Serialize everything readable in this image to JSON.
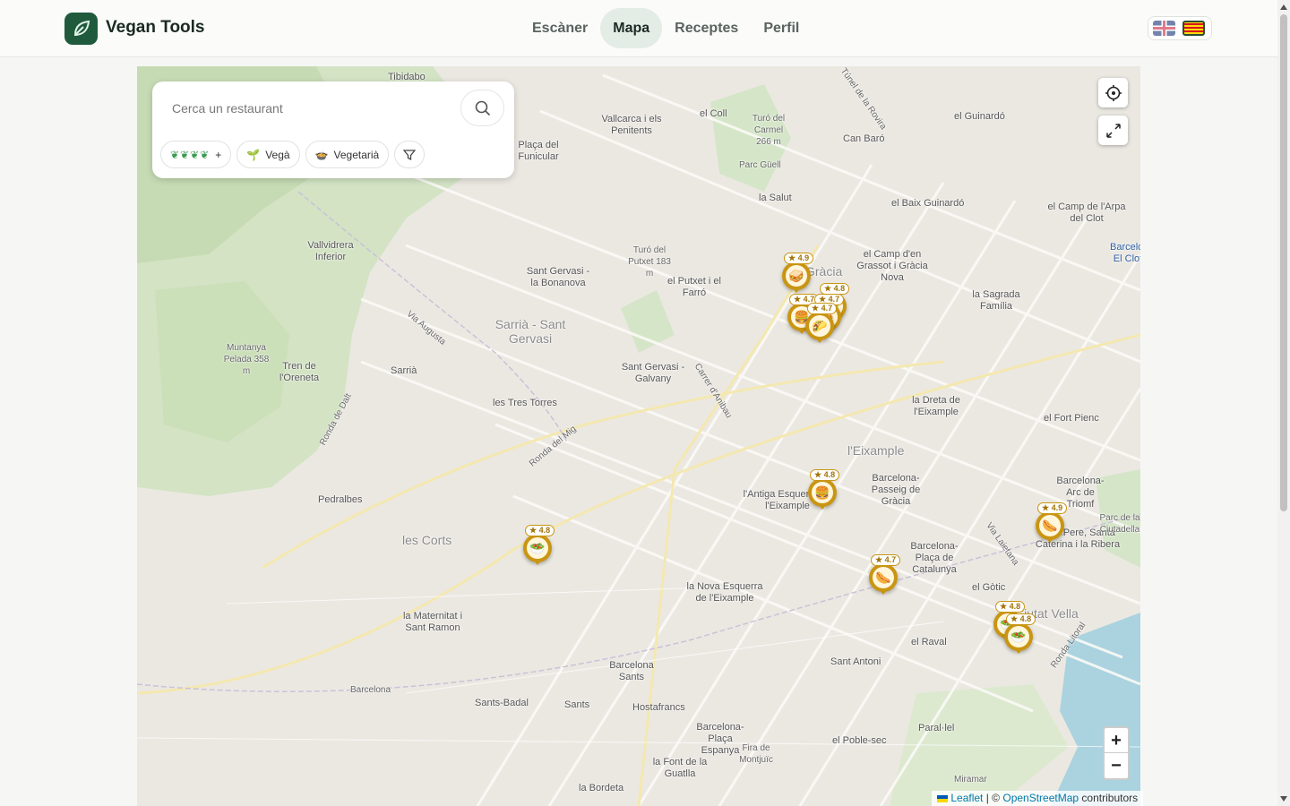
{
  "app": {
    "brand": "Vegan Tools"
  },
  "nav": [
    {
      "label": "Escàner",
      "active": false
    },
    {
      "label": "Mapa",
      "active": true
    },
    {
      "label": "Receptes",
      "active": false
    },
    {
      "label": "Perfil",
      "active": false
    }
  ],
  "languages": [
    "en",
    "ca"
  ],
  "search": {
    "placeholder": "Cerca un restaurant"
  },
  "filters": {
    "rating_plus": "+",
    "vegan_label": "Vegà",
    "vegetarian_label": "Vegetarià"
  },
  "map": {
    "labels": [
      {
        "text": "Tibidabo"
      },
      {
        "text": "Vallcarca i els Penitents"
      },
      {
        "text": "el Coll"
      },
      {
        "text": "Turó del Carmel 266 m"
      },
      {
        "text": "Can Baró"
      },
      {
        "text": "el Guinardó"
      },
      {
        "text": "Plaça del Funicular"
      },
      {
        "text": "la Salut"
      },
      {
        "text": "el Baix Guinardó"
      },
      {
        "text": "el Camp de l'Arpa del Clot"
      },
      {
        "text": "Vallvidrera Inferior"
      },
      {
        "text": "Turó del Putxet 183 m"
      },
      {
        "text": "el Camp d'en Grassot i Gràcia Nova"
      },
      {
        "text": "Sant Gervasi - la Bonanova"
      },
      {
        "text": "el Putxet i el Farró"
      },
      {
        "text": "la Sagrada Família"
      },
      {
        "text": "Sarrià - Sant Gervasi"
      },
      {
        "text": "Muntanya Pelada 358 m"
      },
      {
        "text": "Tren de l'Oreneta"
      },
      {
        "text": "Sarrià"
      },
      {
        "text": "Sant Gervasi - Galvany"
      },
      {
        "text": "les Tres Torres"
      },
      {
        "text": "la Dreta de l'Eixample"
      },
      {
        "text": "el Fort Pienc"
      },
      {
        "text": "l'Eixample"
      },
      {
        "text": "Barcelona-Passeig de Gràcia"
      },
      {
        "text": "Barcelona-Arc de Triomf"
      },
      {
        "text": "Pedralbes"
      },
      {
        "text": "l'Antiga Esquerra de l'Eixample"
      },
      {
        "text": "les Corts"
      },
      {
        "text": "Sant Pere, Santa Caterina i la Ribera"
      },
      {
        "text": "Barcelona-Plaça de Catalunya"
      },
      {
        "text": "la Nova Esquerra de l'Eixample"
      },
      {
        "text": "el Gòtic"
      },
      {
        "text": "Ciutat Vella"
      },
      {
        "text": "la Maternitat i Sant Ramon"
      },
      {
        "text": "Barcelona Sants"
      },
      {
        "text": "el Raval"
      },
      {
        "text": "Sant Antoni"
      },
      {
        "text": "Sants-Badal"
      },
      {
        "text": "Sants"
      },
      {
        "text": "Hostafrancs"
      },
      {
        "text": "Barcelona-Plaça Espanya"
      },
      {
        "text": "Fira de Montjuïc"
      },
      {
        "text": "el Poble-sec"
      },
      {
        "text": "Paral·lel"
      },
      {
        "text": "la Font de la Guatlla"
      },
      {
        "text": "la Bordeta"
      },
      {
        "text": "Barcelona"
      },
      {
        "text": "Miramar"
      },
      {
        "text": "Gràcia"
      },
      {
        "text": "Parc Güell"
      },
      {
        "text": "Ronda del Mig"
      },
      {
        "text": "Via Augusta"
      },
      {
        "text": "Ronda de Dalt"
      },
      {
        "text": "Carrer d'Anibau"
      },
      {
        "text": "Via Laietana"
      },
      {
        "text": "Ronda Litoral"
      },
      {
        "text": "Túnel de la Rovira"
      },
      {
        "text": "Parc de la Ciutadella"
      },
      {
        "text": "Barcelona El Clot"
      }
    ],
    "markers": [
      {
        "rating": "4.9",
        "icon": "🥪",
        "name": "marker-sandwich-gracia"
      },
      {
        "rating": "4.8",
        "icon": "🍔",
        "name": "marker-gracia-2"
      },
      {
        "rating": "4.7",
        "icon": "🍔",
        "name": "marker-gracia-3"
      },
      {
        "rating": "4.7",
        "icon": "🍛",
        "name": "marker-gracia-4"
      },
      {
        "rating": "4.7",
        "icon": "🌮",
        "name": "marker-gracia-5"
      },
      {
        "rating": "4.8",
        "icon": "🍔",
        "name": "marker-eixample-burger"
      },
      {
        "rating": "4.8",
        "icon": "🥗",
        "name": "marker-les-corts-salad"
      },
      {
        "rating": "4.7",
        "icon": "🌭",
        "name": "marker-raval-hotdog"
      },
      {
        "rating": "4.9",
        "icon": "🌭",
        "name": "marker-born-hotdog"
      },
      {
        "rating": "4.8",
        "icon": "🥗",
        "name": "marker-gotic-1"
      },
      {
        "rating": "4.8",
        "icon": "🥗",
        "name": "marker-gotic-2"
      }
    ],
    "zoom_in": "+",
    "zoom_out": "−",
    "attribution": {
      "leaflet": "Leaflet",
      "separator": "| ©",
      "osm": "OpenStreetMap",
      "contributors": "contributors"
    }
  },
  "colors": {
    "brand": "#1f5a3d",
    "marker": "#c99512",
    "accent": "#e4ece6"
  }
}
